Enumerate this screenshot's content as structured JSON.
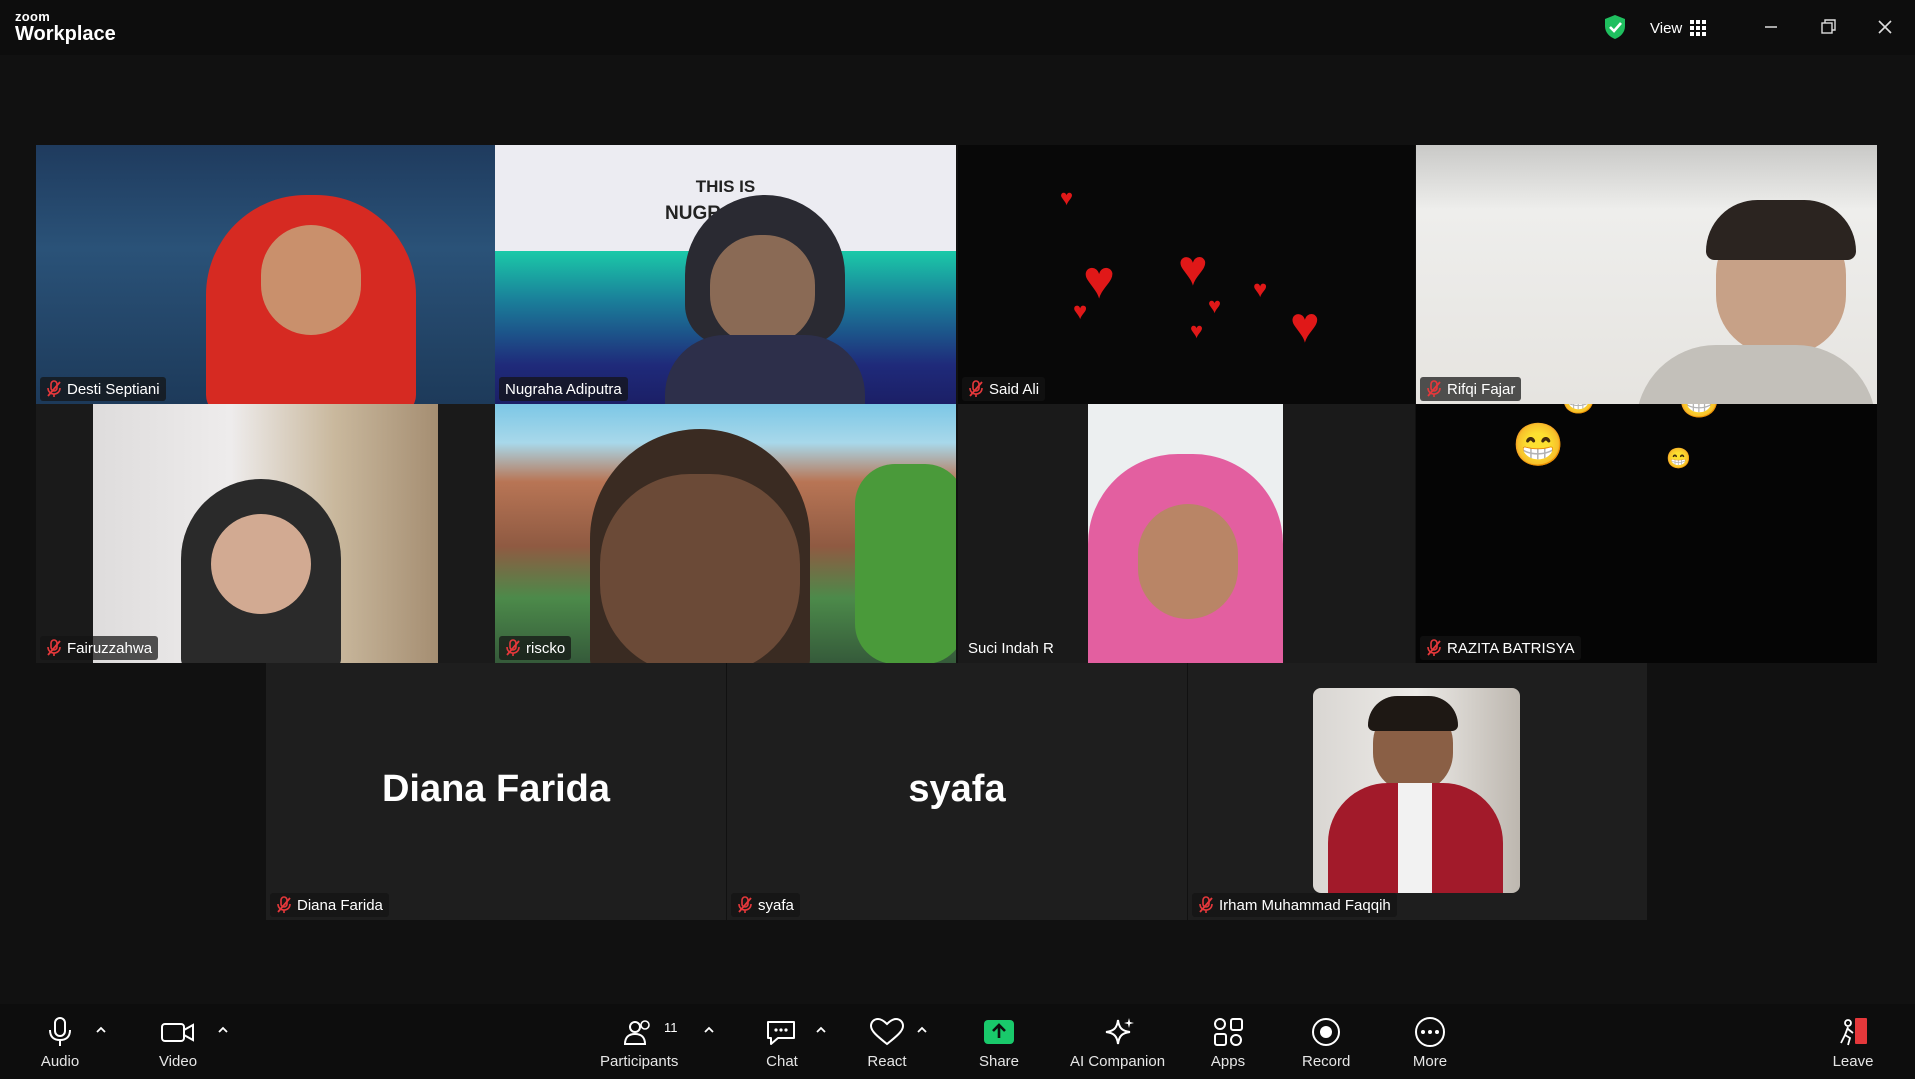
{
  "app": {
    "brand_small": "zoom",
    "brand_large": "Workplace"
  },
  "titlebar": {
    "view_label": "View"
  },
  "participants": {
    "t1": "Desti Septiani",
    "t2": "Nugraha Adiputra",
    "t3": "Said Ali",
    "t4": "Rifqi Fajar",
    "t5": "Fairuzzahwa",
    "t6": "riscko",
    "t7": "Suci Indah R",
    "t8": "RAZITA BATRISYA",
    "t9": "Diana Farida",
    "t10": "syafa",
    "t11": "Irham Muhammad Faqqih"
  },
  "big_names": {
    "diana": "Diana Farida",
    "syafa": "syafa"
  },
  "virtual_bg": {
    "line1": "THIS IS",
    "line2": "NUGRA"
  },
  "toolbar": {
    "audio": "Audio",
    "video": "Video",
    "participants": "Participants",
    "participants_count": "11",
    "chat": "Chat",
    "react": "React",
    "share": "Share",
    "ai_companion": "AI Companion",
    "apps": "Apps",
    "record": "Record",
    "more": "More",
    "leave": "Leave"
  },
  "colors": {
    "active_speaker": "#23d89b",
    "share_green": "#19c96b",
    "leave_red": "#e5383b",
    "mute_red": "#e5383b"
  }
}
